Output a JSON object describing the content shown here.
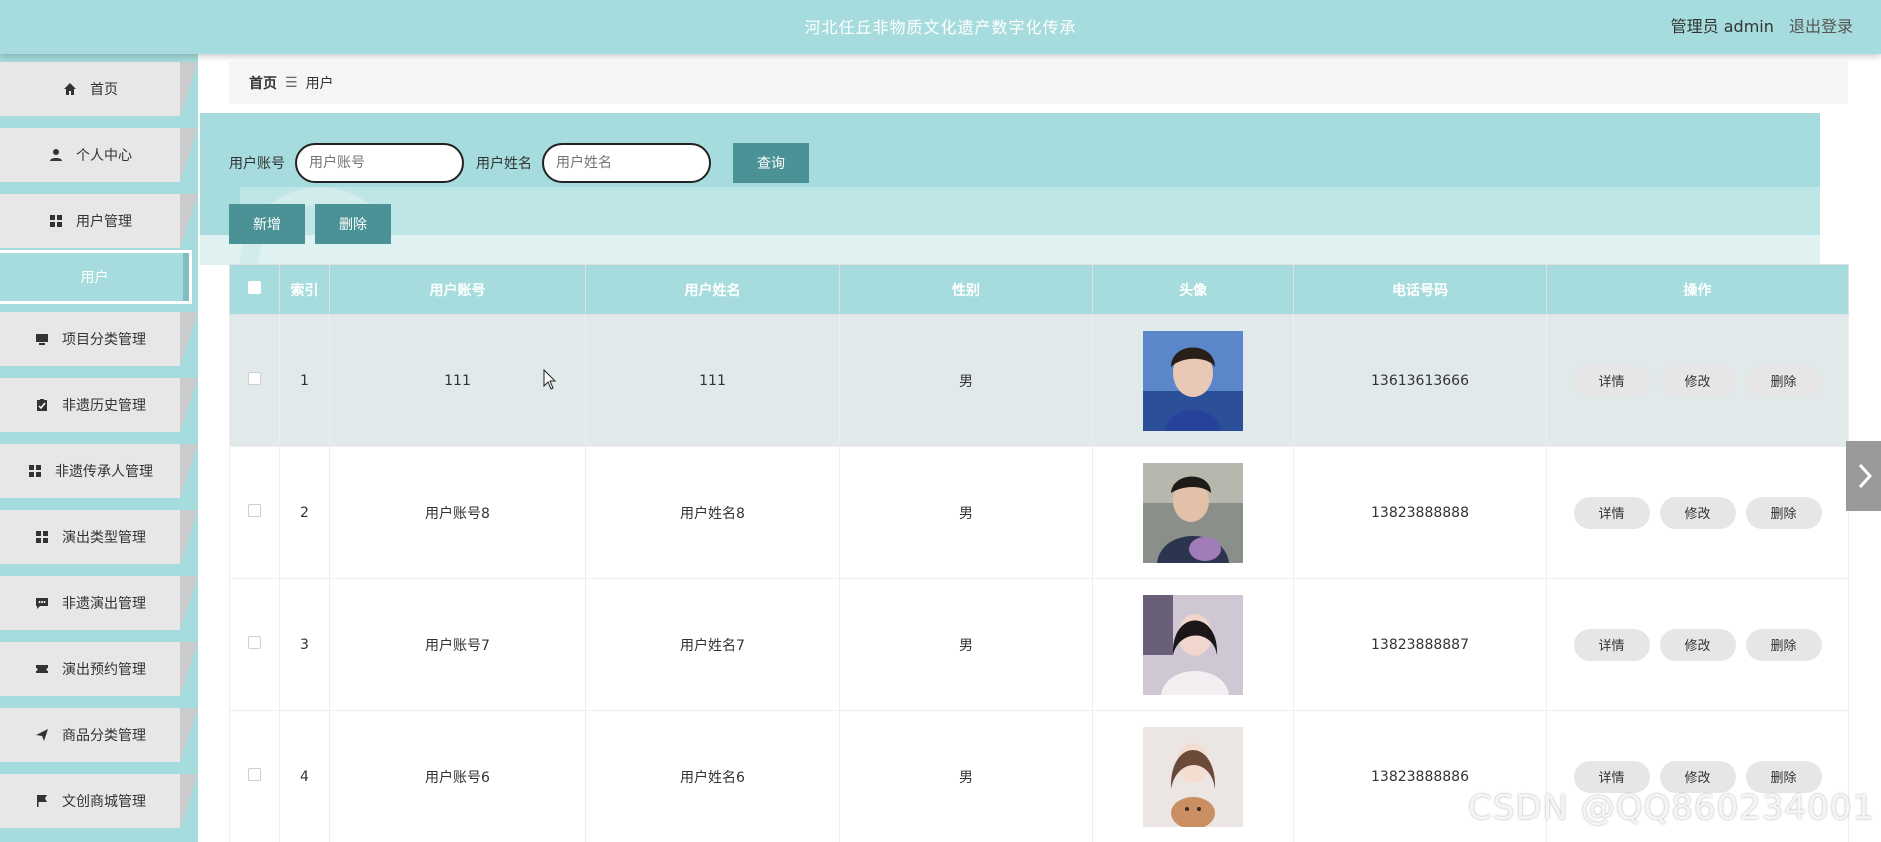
{
  "header": {
    "title": "河北任丘非物质文化遗产数字化传承",
    "user_label": "管理员 admin",
    "logout": "退出登录"
  },
  "sidebar": {
    "items": [
      {
        "label": "首页",
        "icon": "home-icon"
      },
      {
        "label": "个人中心",
        "icon": "person-icon"
      },
      {
        "label": "用户管理",
        "icon": "grid-icon"
      },
      {
        "label": "用户",
        "icon": ""
      },
      {
        "label": "项目分类管理",
        "icon": "monitor-icon"
      },
      {
        "label": "非遗历史管理",
        "icon": "clipboard-icon"
      },
      {
        "label": "非遗传承人管理",
        "icon": "grid-icon"
      },
      {
        "label": "演出类型管理",
        "icon": "grid-icon"
      },
      {
        "label": "非遗演出管理",
        "icon": "chat-icon"
      },
      {
        "label": "演出预约管理",
        "icon": "ticket-icon"
      },
      {
        "label": "商品分类管理",
        "icon": "send-icon"
      },
      {
        "label": "文创商城管理",
        "icon": "flag-icon"
      }
    ]
  },
  "breadcrumb": {
    "home": "首页",
    "sep": "☰",
    "current": "用户"
  },
  "search": {
    "account_label": "用户账号",
    "account_placeholder": "用户账号",
    "name_label": "用户姓名",
    "name_placeholder": "用户姓名",
    "query_button": "查询"
  },
  "actions": {
    "add": "新增",
    "delete": "删除"
  },
  "table": {
    "headers": [
      "索引",
      "用户账号",
      "用户姓名",
      "性别",
      "头像",
      "电话号码",
      "操作"
    ],
    "rows": [
      {
        "index": "1",
        "account": "111",
        "name": "111",
        "gender": "男",
        "phone": "13613613666"
      },
      {
        "index": "2",
        "account": "用户账号8",
        "name": "用户姓名8",
        "gender": "男",
        "phone": "13823888888"
      },
      {
        "index": "3",
        "account": "用户账号7",
        "name": "用户姓名7",
        "gender": "男",
        "phone": "13823888887"
      },
      {
        "index": "4",
        "account": "用户账号6",
        "name": "用户姓名6",
        "gender": "男",
        "phone": "13823888886"
      }
    ],
    "row_actions": {
      "detail": "详情",
      "edit": "修改",
      "delete": "删除"
    }
  },
  "watermark": "CSDN @QQ860234001",
  "colors": {
    "accent": "#a6dcdd",
    "button": "#4a9295",
    "menu_bg": "#e7e7e8"
  }
}
